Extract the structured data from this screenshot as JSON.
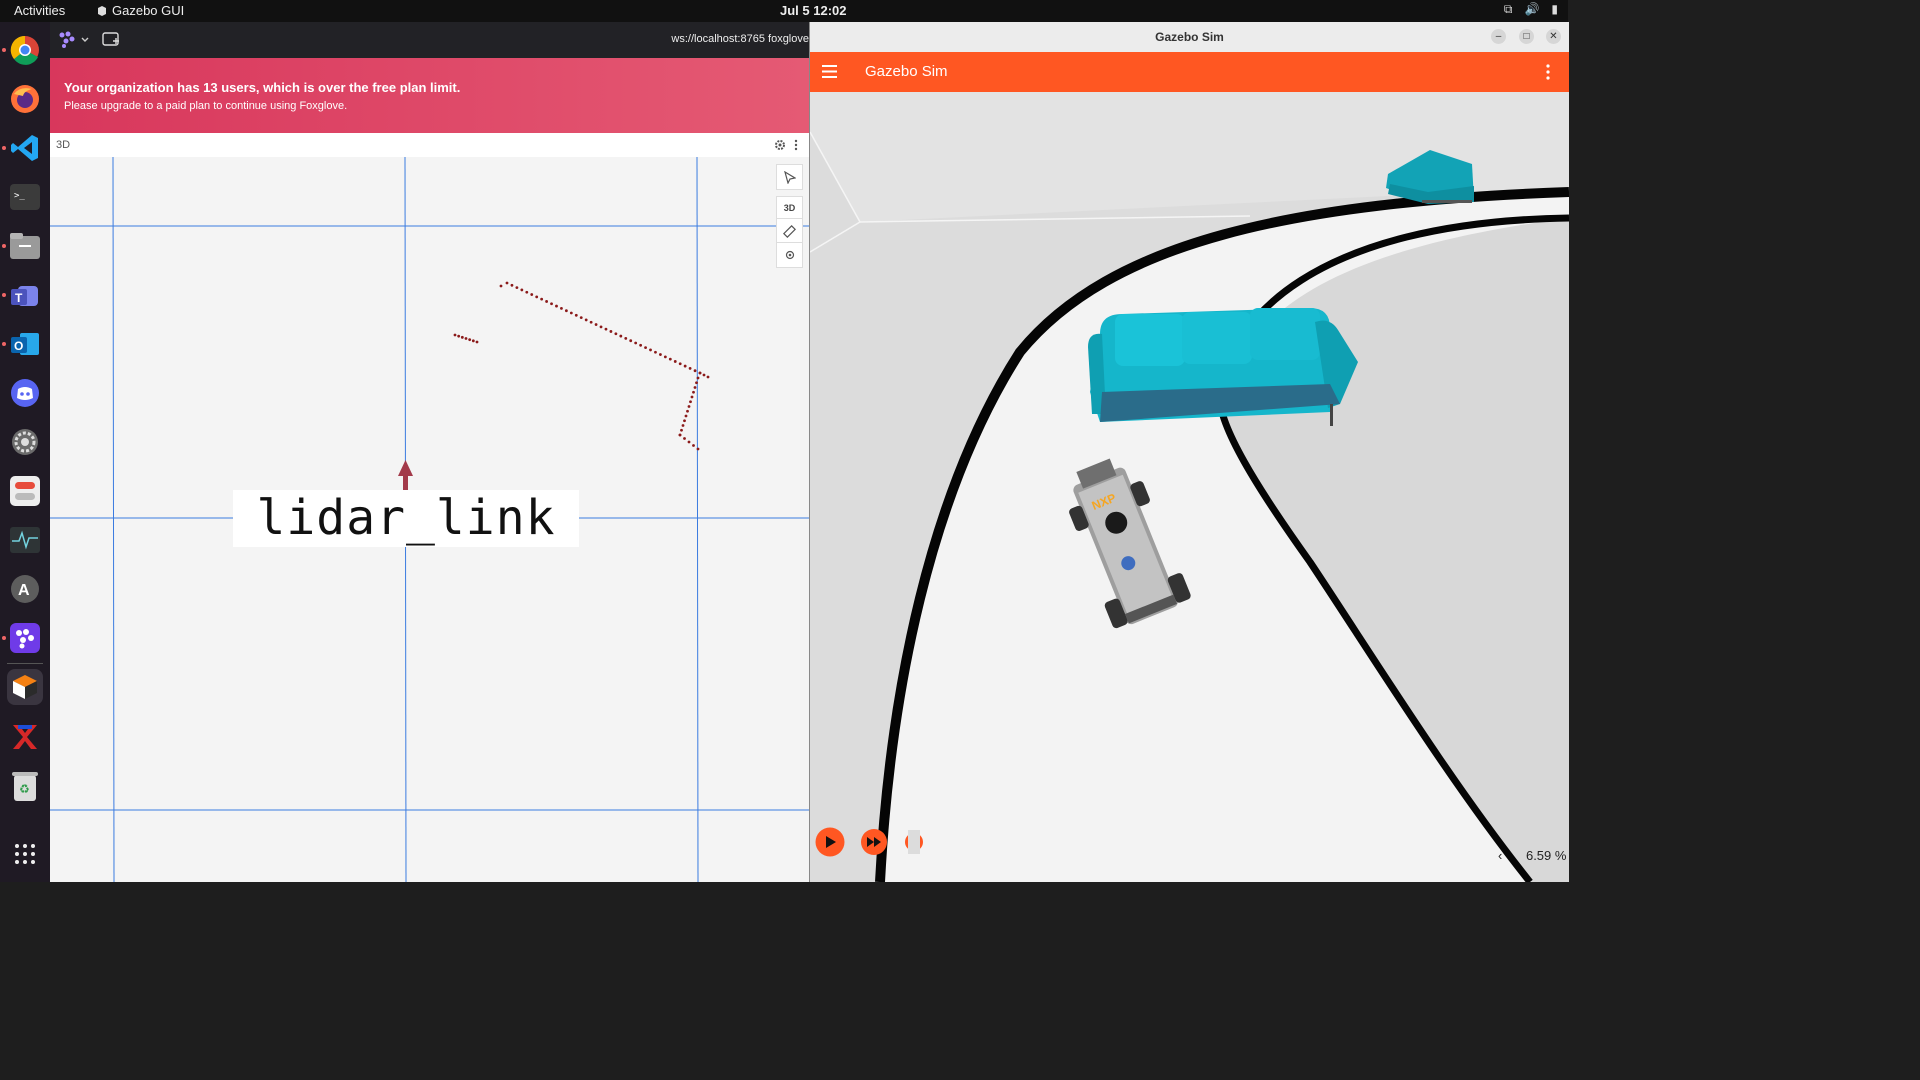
{
  "topbar": {
    "activities": "Activities",
    "app_name": "Gazebo GUI",
    "clock": "Jul 5  12:02"
  },
  "dock": {
    "items": [
      "chrome-icon",
      "firefox-icon",
      "vscode-icon",
      "terminal-icon",
      "files-icon",
      "teams-icon",
      "outlook-icon",
      "discord-icon",
      "settings-icon",
      "toggle-app-icon",
      "system-monitor-icon",
      "app-center-icon",
      "foxglove-icon",
      "gazebo-icon",
      "xodr-icon",
      "trash-icon",
      "show-apps-icon"
    ]
  },
  "foxglove": {
    "url": "ws://localhost:8765 foxglove",
    "banner_title": "Your organization has 13 users, which is over the free plan limit.",
    "banner_subtitle": "Please upgrade to a paid plan to continue using Foxglove.",
    "panel_title": "3D",
    "view_mode": "3D",
    "frame_label": "lidar_link"
  },
  "gazebo": {
    "window_title": "Gazebo Sim",
    "app_title": "Gazebo Sim",
    "rtf_value": "6.59 %",
    "rtf_arrow": "‹",
    "accent": "#ff5722"
  },
  "colors": {
    "banner": "#d8375c",
    "grid": "#3a7be0",
    "lidar_points": "#8b1a1a",
    "sofa": "#12b3c8"
  }
}
